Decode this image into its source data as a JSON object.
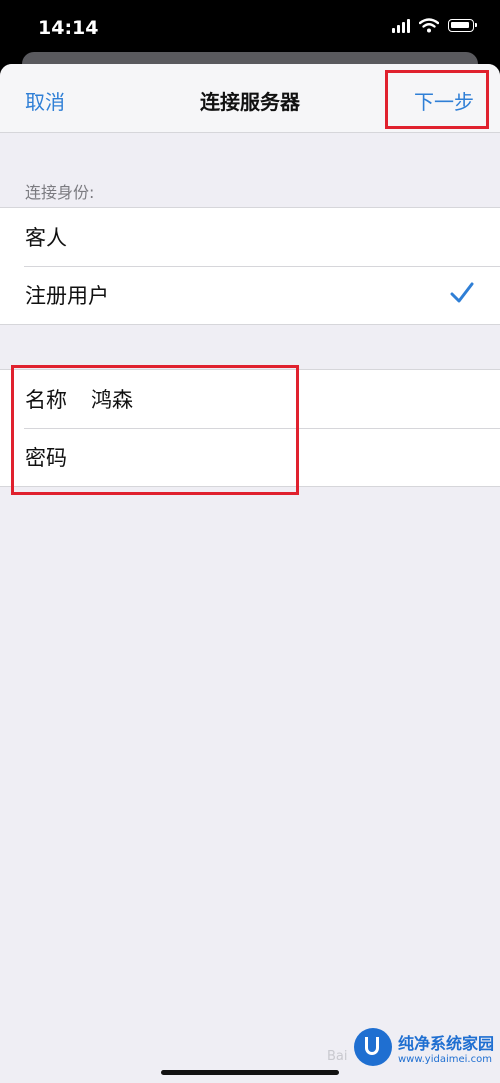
{
  "status": {
    "time": "14:14"
  },
  "nav": {
    "cancel": "取消",
    "title": "连接服务器",
    "next": "下一步"
  },
  "identity": {
    "header": "连接身份:",
    "options": [
      {
        "label": "客人",
        "selected": false
      },
      {
        "label": "注册用户",
        "selected": true
      }
    ]
  },
  "credentials": {
    "name_label": "名称",
    "name_value": "鸿森",
    "password_label": "密码"
  },
  "watermark": {
    "title": "纯净系统家园",
    "url": "www.yidaimei.com",
    "baidu": "Bai"
  },
  "colors": {
    "accent": "#2f7fd6",
    "highlight_box": "#e0212e",
    "background": "#efeef4"
  }
}
